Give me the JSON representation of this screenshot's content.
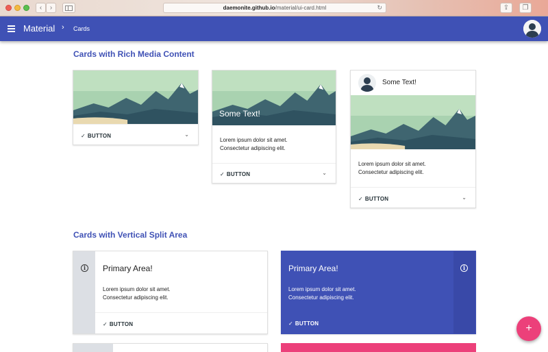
{
  "browser": {
    "url_host": "daemonite.github.io",
    "url_path": "/material/ui-card.html",
    "back_icon": "chevron-left-icon",
    "forward_icon": "chevron-right-icon",
    "reload_icon": "reload-icon"
  },
  "appbar": {
    "menu_icon": "menu-icon",
    "title": "Material",
    "breadcrumb_sep": "›",
    "breadcrumb": "Cards",
    "color": "#3f51b5"
  },
  "section_rich": {
    "title": "Cards with Rich Media Content",
    "card1": {
      "button": "BUTTON",
      "check": "✓",
      "chevron": "⌄"
    },
    "card2": {
      "overlay_title": "Some Text!",
      "text_line1": "Lorem ipsum dolor sit amet.",
      "text_line2": "Consectetur adipiscing elit.",
      "button": "BUTTON",
      "check": "✓",
      "chevron": "⌄"
    },
    "card3": {
      "header_text": "Some Text!",
      "text_line1": "Lorem ipsum dolor sit amet.",
      "text_line2": "Consectetur adipiscing elit.",
      "button": "BUTTON",
      "check": "✓",
      "chevron": "⌄"
    }
  },
  "section_split": {
    "title": "Cards with Vertical Split Area",
    "card_light": {
      "info_icon": "i",
      "title": "Primary Area!",
      "text_line1": "Lorem ipsum dolor sit amet.",
      "text_line2": "Consectetur adipiscing elit.",
      "button": "BUTTON",
      "check": "✓"
    },
    "card_primary": {
      "info_icon": "i",
      "title": "Primary Area!",
      "text_line1": "Lorem ipsum dolor sit amet.",
      "text_line2": "Consectetur adipiscing elit.",
      "button": "BUTTON",
      "check": "✓",
      "color": "#3f51b5"
    },
    "accent_color": "#ec407a"
  },
  "fab": {
    "label": "+"
  }
}
